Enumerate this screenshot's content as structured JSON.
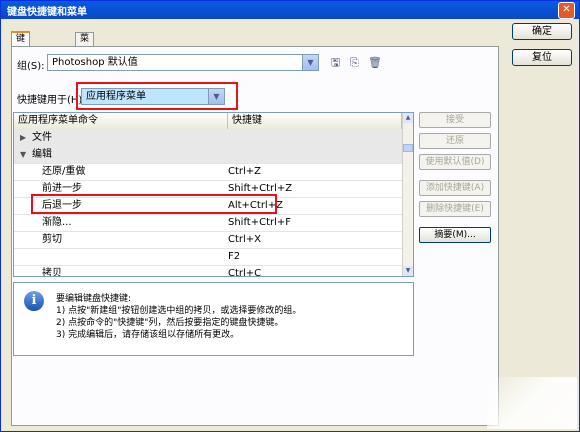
{
  "window": {
    "title": "键盘快捷键和菜单",
    "close_glyph": "✕"
  },
  "tabs": [
    {
      "label": "键盘快捷键"
    },
    {
      "label": "菜单"
    }
  ],
  "group": {
    "label": "组(S):",
    "value": "Photoshop 默认值"
  },
  "shortcuts_for": {
    "label": "快捷键用于(H):",
    "value": "应用程序菜单"
  },
  "table": {
    "headers": [
      "应用程序菜单命令",
      "快捷键"
    ],
    "rows": [
      {
        "kind": "group",
        "command": "文件",
        "shortcut": "",
        "expanded": false
      },
      {
        "kind": "group",
        "command": "编辑",
        "shortcut": "",
        "expanded": true
      },
      {
        "kind": "item",
        "command": "还原/重做",
        "shortcut": "Ctrl+Z"
      },
      {
        "kind": "item",
        "command": "前进一步",
        "shortcut": "Shift+Ctrl+Z"
      },
      {
        "kind": "item",
        "command": "后退一步",
        "shortcut": "Alt+Ctrl+Z",
        "highlighted": true
      },
      {
        "kind": "item",
        "command": "渐隐...",
        "shortcut": "Shift+Ctrl+F"
      },
      {
        "kind": "item",
        "command": "剪切",
        "shortcut": "Ctrl+X"
      },
      {
        "kind": "item",
        "command": "",
        "shortcut": "F2"
      },
      {
        "kind": "item",
        "command": "拷贝",
        "shortcut": "Ctrl+C"
      }
    ]
  },
  "side_buttons": [
    {
      "label": "接受",
      "enabled": false
    },
    {
      "label": "还原",
      "enabled": false
    },
    {
      "label": "使用默认值(D)",
      "enabled": false
    },
    {
      "label": "添加快捷键(A)",
      "enabled": false
    },
    {
      "label": "删除快捷键(E)",
      "enabled": false
    },
    {
      "label": "摘要(M)...",
      "enabled": true
    }
  ],
  "main_buttons": {
    "ok": "确定",
    "reset": "复位"
  },
  "info": {
    "icon_glyph": "i",
    "lines": [
      "要编辑键盘快捷键:",
      "1) 点按\"新建组\"按钮创建选中组的拷贝，或选择要修改的组。",
      "2) 点按命令的\"快捷键\"列，然后按要指定的键盘快捷键。",
      "3) 完成编辑后，请存储该组以存储所有更改。"
    ]
  },
  "icons": {
    "combo_arrow": "▼",
    "save": "🖫",
    "save_as": "⎘",
    "delete": "🗑",
    "collapsed": "▶",
    "expanded": "▼",
    "scroll_up": "▲",
    "scroll_down": "▼"
  },
  "colors": {
    "highlight_box": "#e0131f",
    "titlebar": "#0854d6"
  }
}
